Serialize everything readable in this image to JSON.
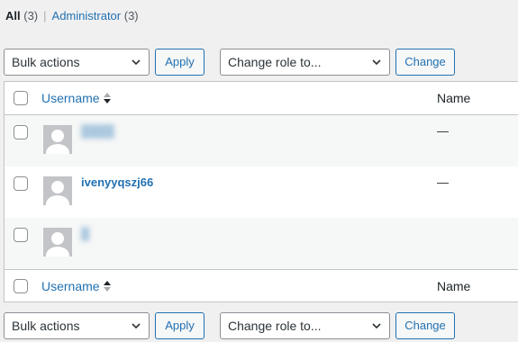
{
  "filters": {
    "all_label": "All",
    "all_count": "(3)",
    "separator": "|",
    "admin_label": "Administrator",
    "admin_count": "(3)"
  },
  "top_nav": {
    "bulk_actions": "Bulk actions",
    "apply": "Apply",
    "change_role": "Change role to...",
    "change": "Change"
  },
  "bottom_nav": {
    "bulk_actions": "Bulk actions",
    "apply": "Apply",
    "change_role": "Change role to...",
    "change": "Change"
  },
  "table": {
    "headers": {
      "username": "Username",
      "name": "Name"
    },
    "rows": [
      {
        "username": "████",
        "name": "—",
        "obscured": true
      },
      {
        "username": "ivenyyqszj66",
        "name": "—",
        "obscured": false
      },
      {
        "username": "█",
        "name": "",
        "obscured": true
      }
    ]
  },
  "colors": {
    "link": "#2271b1",
    "background": "#f0f0f1",
    "border": "#c3c4c7"
  },
  "icons": [
    "chevron-down-icon",
    "sort-icon",
    "avatar-icon"
  ]
}
